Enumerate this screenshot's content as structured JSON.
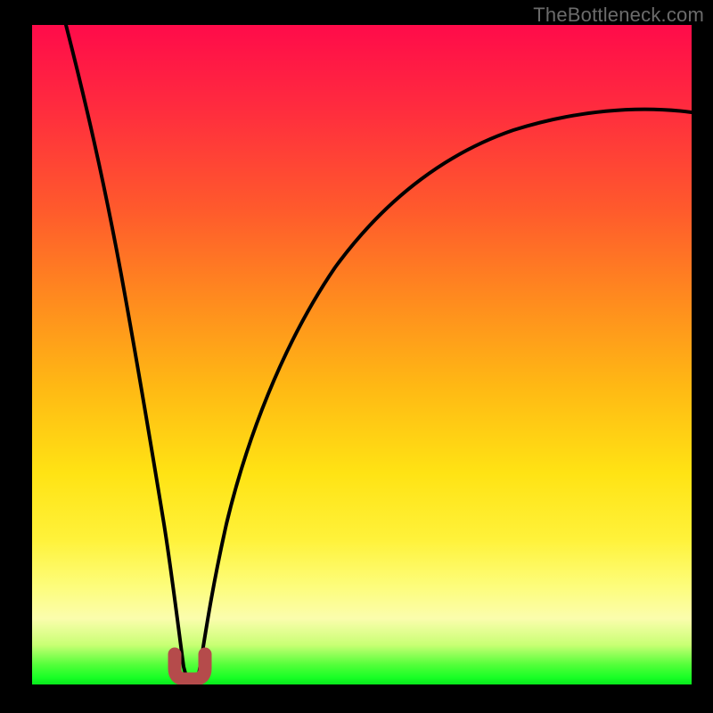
{
  "watermark": {
    "text": "TheBottleneck.com"
  },
  "colors": {
    "background": "#000000",
    "curve": "#000000",
    "bump": "#b54b4b",
    "gradient_stops": [
      "#ff0b4a",
      "#ff2a3f",
      "#ff5a2c",
      "#ff8c1e",
      "#ffb914",
      "#ffe314",
      "#fff23a",
      "#fdfd7a",
      "#fbfdad",
      "#c9ff74",
      "#54ff3a",
      "#17ff25",
      "#08e81c"
    ]
  },
  "chart_data": {
    "type": "line",
    "title": "",
    "xlabel": "",
    "ylabel": "",
    "xlim": [
      0,
      100
    ],
    "ylim": [
      0,
      100
    ],
    "note": "Background vertical gradient encodes bottleneck severity (red≈100 bad, green≈0 good). Two black curves descend to a shared minimum near x≈22; left branch nearly vertical, right branch rises asymptotically toward top-right. Small rounded pink-brown bump at the minimum.",
    "series": [
      {
        "name": "left-branch",
        "x": [
          5,
          7,
          9,
          11,
          13,
          15,
          17,
          19,
          20,
          21,
          22
        ],
        "y": [
          100,
          90,
          79,
          68,
          57,
          45,
          33,
          20,
          12,
          5,
          0
        ]
      },
      {
        "name": "right-branch",
        "x": [
          22,
          24,
          26,
          30,
          35,
          40,
          45,
          50,
          55,
          60,
          65,
          70,
          75,
          80,
          85,
          90,
          95,
          100
        ],
        "y": [
          0,
          10,
          19,
          33,
          46,
          55,
          62,
          67,
          71,
          74,
          77,
          79,
          81,
          82,
          83,
          84,
          85,
          86
        ]
      }
    ],
    "marker": {
      "name": "min-bump",
      "x": 22.5,
      "y": 1.2,
      "width": 4,
      "height": 4,
      "color": "#b54b4b"
    }
  }
}
